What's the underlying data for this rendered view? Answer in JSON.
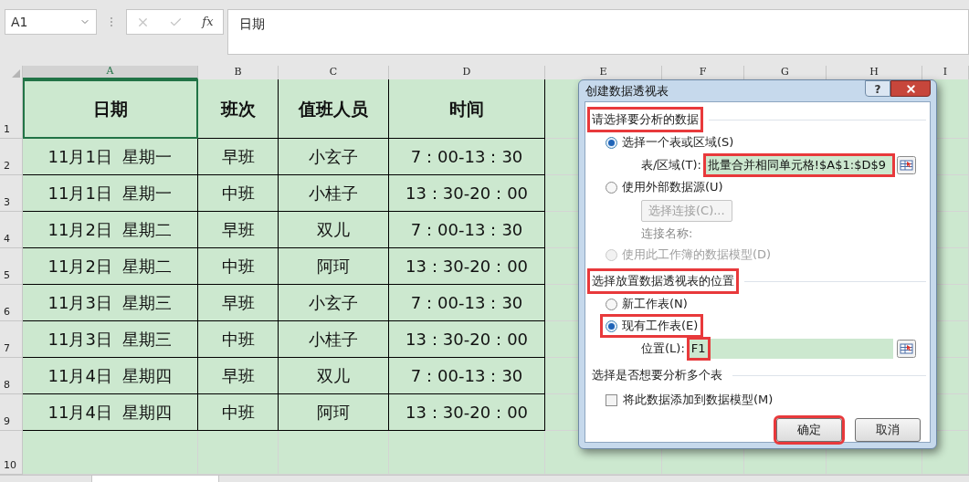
{
  "formula_bar": {
    "name_box": "A1",
    "function_label": "fx",
    "formula": "日期"
  },
  "columns": [
    {
      "label": "A",
      "selected": true
    },
    {
      "label": "B",
      "selected": false
    },
    {
      "label": "C",
      "selected": false
    },
    {
      "label": "D",
      "selected": false
    },
    {
      "label": "E",
      "selected": false
    },
    {
      "label": "F",
      "selected": false
    },
    {
      "label": "G",
      "selected": false
    },
    {
      "label": "H",
      "selected": false
    },
    {
      "label": "I",
      "selected": false
    }
  ],
  "rows": [
    {
      "number": "1",
      "kind": "header",
      "cells": [
        {
          "text": "日期",
          "selected": true
        },
        {
          "text": "班次",
          "selected": false
        },
        {
          "text": "值班人员",
          "selected": false
        },
        {
          "text": "时间",
          "selected": false
        }
      ]
    },
    {
      "number": "2",
      "kind": "data",
      "cells": [
        {
          "text": "11月1日  星期一",
          "selected": false
        },
        {
          "text": "早班",
          "selected": false
        },
        {
          "text": "小玄子",
          "selected": false
        },
        {
          "text": "7：00-13：30",
          "selected": false
        }
      ]
    },
    {
      "number": "3",
      "kind": "data",
      "cells": [
        {
          "text": "11月1日  星期一",
          "selected": false
        },
        {
          "text": "中班",
          "selected": false
        },
        {
          "text": "小桂子",
          "selected": false
        },
        {
          "text": "13：30-20：00",
          "selected": false
        }
      ]
    },
    {
      "number": "4",
      "kind": "data",
      "cells": [
        {
          "text": "11月2日  星期二",
          "selected": false
        },
        {
          "text": "早班",
          "selected": false
        },
        {
          "text": "双儿",
          "selected": false
        },
        {
          "text": "7：00-13：30",
          "selected": false
        }
      ]
    },
    {
      "number": "5",
      "kind": "data",
      "cells": [
        {
          "text": "11月2日  星期二",
          "selected": false
        },
        {
          "text": "中班",
          "selected": false
        },
        {
          "text": "阿珂",
          "selected": false
        },
        {
          "text": "13：30-20：00",
          "selected": false
        }
      ]
    },
    {
      "number": "6",
      "kind": "data",
      "cells": [
        {
          "text": "11月3日  星期三",
          "selected": false
        },
        {
          "text": "早班",
          "selected": false
        },
        {
          "text": "小玄子",
          "selected": false
        },
        {
          "text": "7：00-13：30",
          "selected": false
        }
      ]
    },
    {
      "number": "7",
      "kind": "data",
      "cells": [
        {
          "text": "11月3日  星期三",
          "selected": false
        },
        {
          "text": "中班",
          "selected": false
        },
        {
          "text": "小桂子",
          "selected": false
        },
        {
          "text": "13：30-20：00",
          "selected": false
        }
      ]
    },
    {
      "number": "8",
      "kind": "data",
      "cells": [
        {
          "text": "11月4日  星期四",
          "selected": false
        },
        {
          "text": "早班",
          "selected": false
        },
        {
          "text": "双儿",
          "selected": false
        },
        {
          "text": "7：00-13：30",
          "selected": false
        }
      ]
    },
    {
      "number": "9",
      "kind": "data",
      "cells": [
        {
          "text": "11月4日  星期四",
          "selected": false
        },
        {
          "text": "中班",
          "selected": false
        },
        {
          "text": "阿珂",
          "selected": false
        },
        {
          "text": "13：30-20：00",
          "selected": false
        }
      ]
    },
    {
      "number": "10",
      "kind": "empty"
    }
  ],
  "dialog": {
    "title": "创建数据透视表",
    "help": "?",
    "items": [
      {
        "kind": "heading",
        "text": "请选择要分析的数据",
        "highlighted": true
      },
      {
        "kind": "radio",
        "text": "选择一个表或区域(S)",
        "selected": true,
        "disabled": false,
        "highlighted": false
      },
      {
        "kind": "field",
        "label": "表/区域(T):",
        "value": "批量合并相同单元格!$A$1:$D$9",
        "highlighted": true,
        "value_highlighted": false
      },
      {
        "kind": "radio",
        "text": "使用外部数据源(U)",
        "selected": false,
        "disabled": false,
        "highlighted": false
      },
      {
        "kind": "button",
        "text": "选择连接(C)...",
        "disabled": true
      },
      {
        "kind": "note",
        "text": "连接名称:"
      },
      {
        "kind": "radio",
        "text": "使用此工作簿的数据模型(D)",
        "selected": false,
        "disabled": true,
        "highlighted": false
      },
      {
        "kind": "heading",
        "text": "选择放置数据透视表的位置",
        "highlighted": true
      },
      {
        "kind": "radio",
        "text": "新工作表(N)",
        "selected": false,
        "disabled": false,
        "highlighted": false
      },
      {
        "kind": "radio",
        "text": "现有工作表(E)",
        "selected": true,
        "disabled": false,
        "highlighted": true
      },
      {
        "kind": "field",
        "label": "位置(L):",
        "value": "F1",
        "highlighted": false,
        "value_highlighted": true
      },
      {
        "kind": "heading",
        "text": "选择是否想要分析多个表",
        "highlighted": false
      },
      {
        "kind": "checkbox",
        "text": "将此数据添加到数据模型(M)",
        "checked": false
      }
    ],
    "buttons": [
      {
        "text": "确定",
        "highlighted": true
      },
      {
        "text": "取消",
        "highlighted": false
      }
    ]
  }
}
